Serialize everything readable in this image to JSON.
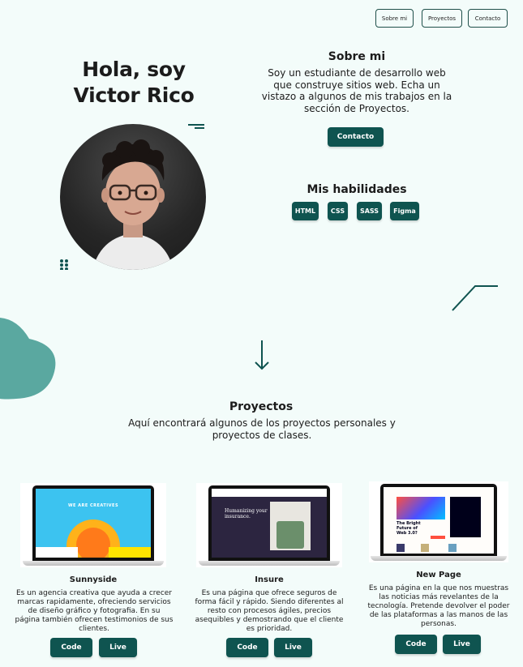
{
  "nav": {
    "about_label": "Sobre mi",
    "projects_label": "Proyectos",
    "contact_label": "Contacto"
  },
  "hero": {
    "title": "Hola, soy Victor Rico"
  },
  "about": {
    "heading": "Sobre mi",
    "text": "Soy un estudiante de desarrollo web que construye sitios web. Echa un vistazo a algunos de mis trabajos en la sección de Proyectos.",
    "contact_button": "Contacto"
  },
  "skills": {
    "heading": "Mis habilidades",
    "items": [
      "HTML",
      "CSS",
      "SASS",
      "Figma"
    ]
  },
  "projects": {
    "heading": "Proyectos",
    "subtitle": "Aquí encontrará algunos de los proyectos personales y proyectos de clases.",
    "items": [
      {
        "title": "Sunnyside",
        "description": "Es un agencia creativa que ayuda a crecer marcas rapidamente, ofreciendo servicios de diseño gráfico y fotografia. En su página también ofrecen testimonios de sus clientes.",
        "code_label": "Code",
        "live_label": "Live",
        "screen_heading": "WE ARE CREATIVES"
      },
      {
        "title": "Insure",
        "description": "Es una página que ofrece seguros de forma fácil y rápido. Siendo diferentes al resto con procesos ágiles, precios asequibles y demostrando que el cliente es prioridad.",
        "code_label": "Code",
        "live_label": "Live",
        "screen_heading": "Humanizing your insurance."
      },
      {
        "title": "New Page",
        "description": "Es una página en la que nos muestras las noticias más revelantes de la tecnología. Pretende devolver el poder de las plataformas a las manos de las personas.",
        "code_label": "Code",
        "live_label": "Live",
        "screen_heading": "The Bright Future of Web 3.0?"
      }
    ]
  },
  "colors": {
    "background": "#f3fcfa",
    "accent": "#0f5450",
    "blob": "#5aa8a0"
  }
}
